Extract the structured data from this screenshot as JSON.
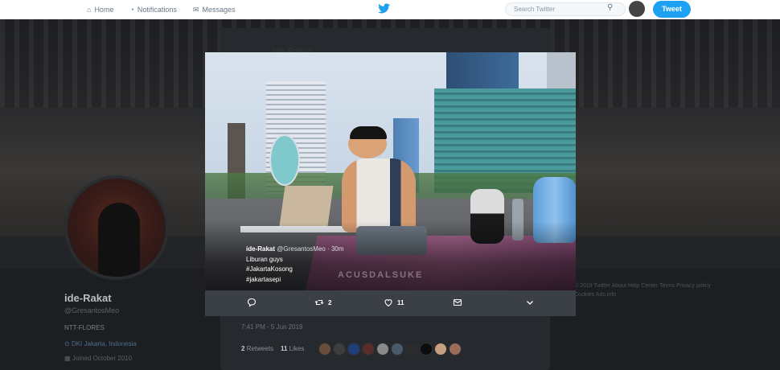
{
  "topbar": {
    "nav": [
      {
        "label": "Home",
        "icon": "home-icon"
      },
      {
        "label": "Notifications",
        "icon": "bell-icon"
      },
      {
        "label": "Messages",
        "icon": "envelope-icon"
      }
    ],
    "search_placeholder": "Search Twitter",
    "tweet_button": "Tweet"
  },
  "profile": {
    "name": "ide-Rakat",
    "handle": "@GresantosMeo",
    "bio": "NTT-FLORES",
    "location": "DKI Jakarta, Indonesia",
    "joined": "Joined October 2010"
  },
  "tweet": {
    "author_name": "ide-Rakat",
    "timestamp": "7:41 PM - 5 Jun 2019",
    "retweets_count": "2",
    "retweets_label": "Retweets",
    "likes_count": "11",
    "likes_label": "Likes",
    "liker_colors": [
      "#6b4d3a",
      "#3d3d3d",
      "#1e3f7a",
      "#5a2d2d",
      "#8a8a8a",
      "#4a5a6a",
      "#2b2b2b",
      "#0d0d0d",
      "#c8a080",
      "#9c6b5a"
    ]
  },
  "footer": {
    "links": [
      "© 2019 Twitter",
      "About",
      "Help Center",
      "Terms",
      "Privacy policy",
      "Cookies",
      "Ads info"
    ]
  },
  "modal": {
    "close_label": "✕",
    "caption": {
      "name": "ide-Rakat",
      "handle": "@GresantosMeo",
      "time": "· 30m",
      "line1": "Liburan guys",
      "line2": "#JakartaKosong",
      "line3": "#jakartasepi"
    },
    "watermark": "ACUSDALSUKE",
    "actions": {
      "retweets": "2",
      "likes": "11"
    }
  },
  "colors": {
    "accent": "#1da1f2",
    "action_bar": "#3b4046"
  }
}
